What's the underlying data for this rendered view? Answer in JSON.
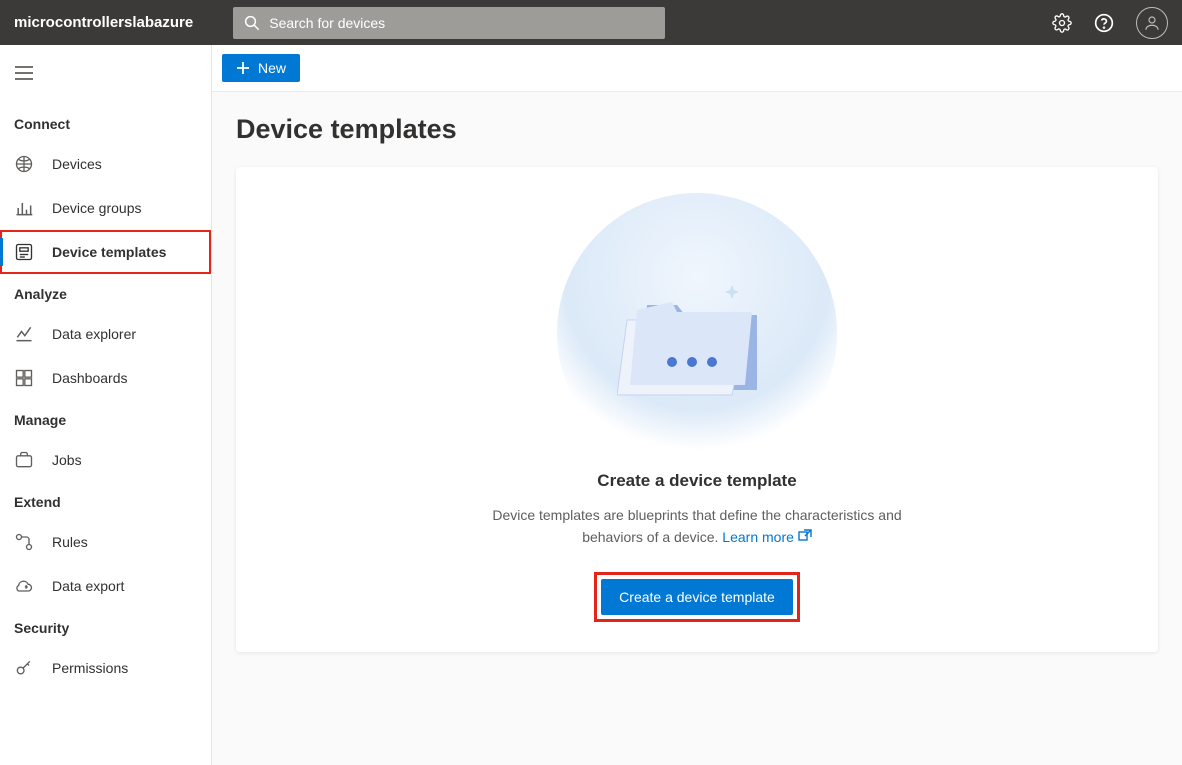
{
  "app": {
    "title": "microcontrollerslabazure"
  },
  "search": {
    "placeholder": "Search for devices"
  },
  "sidebar": {
    "sections": [
      {
        "title": "Connect",
        "items": [
          {
            "id": "devices",
            "label": "Devices"
          },
          {
            "id": "device-groups",
            "label": "Device groups"
          },
          {
            "id": "device-templates",
            "label": "Device templates",
            "active": true,
            "highlighted": true
          }
        ]
      },
      {
        "title": "Analyze",
        "items": [
          {
            "id": "data-explorer",
            "label": "Data explorer"
          },
          {
            "id": "dashboards",
            "label": "Dashboards"
          }
        ]
      },
      {
        "title": "Manage",
        "items": [
          {
            "id": "jobs",
            "label": "Jobs"
          }
        ]
      },
      {
        "title": "Extend",
        "items": [
          {
            "id": "rules",
            "label": "Rules"
          },
          {
            "id": "data-export",
            "label": "Data export"
          }
        ]
      },
      {
        "title": "Security",
        "items": [
          {
            "id": "permissions",
            "label": "Permissions"
          }
        ]
      }
    ]
  },
  "commandbar": {
    "new_label": "New"
  },
  "page": {
    "title": "Device templates"
  },
  "empty": {
    "heading": "Create a device template",
    "description": "Device templates are blueprints that define the characteristics and behaviors of a device. ",
    "learn_more": "Learn more",
    "button": "Create a device template"
  }
}
